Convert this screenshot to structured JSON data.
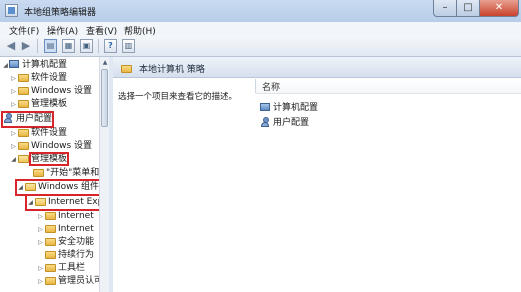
{
  "window": {
    "title": "本地组策略编辑器",
    "controls": {
      "min": "–",
      "max": "□",
      "close": "✕"
    }
  },
  "menubar": [
    "文件(F)",
    "操作(A)",
    "查看(V)",
    "帮助(H)"
  ],
  "toolbar": {
    "back_icon": "arrow-left-icon",
    "forward_icon": "arrow-right-icon",
    "help_label": "?"
  },
  "tree": {
    "computer_config": "计算机配置",
    "cc_software": "软件设置",
    "cc_windows": "Windows 设置",
    "cc_admin": "管理模板",
    "user_config": "用户配置",
    "uc_software": "软件设置",
    "uc_windows": "Windows 设置",
    "uc_admin": "管理模板",
    "start_menu": "\"开始\"菜单和任",
    "win_components": "Windows 组件",
    "ie": "Internet Exp",
    "ie_child1": "Internet ",
    "ie_child2": "Internet ",
    "security": "安全功能",
    "persistence": "持续行为",
    "toolbars": "工具栏",
    "admin_approved": "管理员认可"
  },
  "details": {
    "header_title": "本地计算机 策略",
    "description": "选择一个项目来查看它的描述。",
    "column_name": "名称",
    "items": [
      "计算机配置",
      "用户配置"
    ]
  }
}
